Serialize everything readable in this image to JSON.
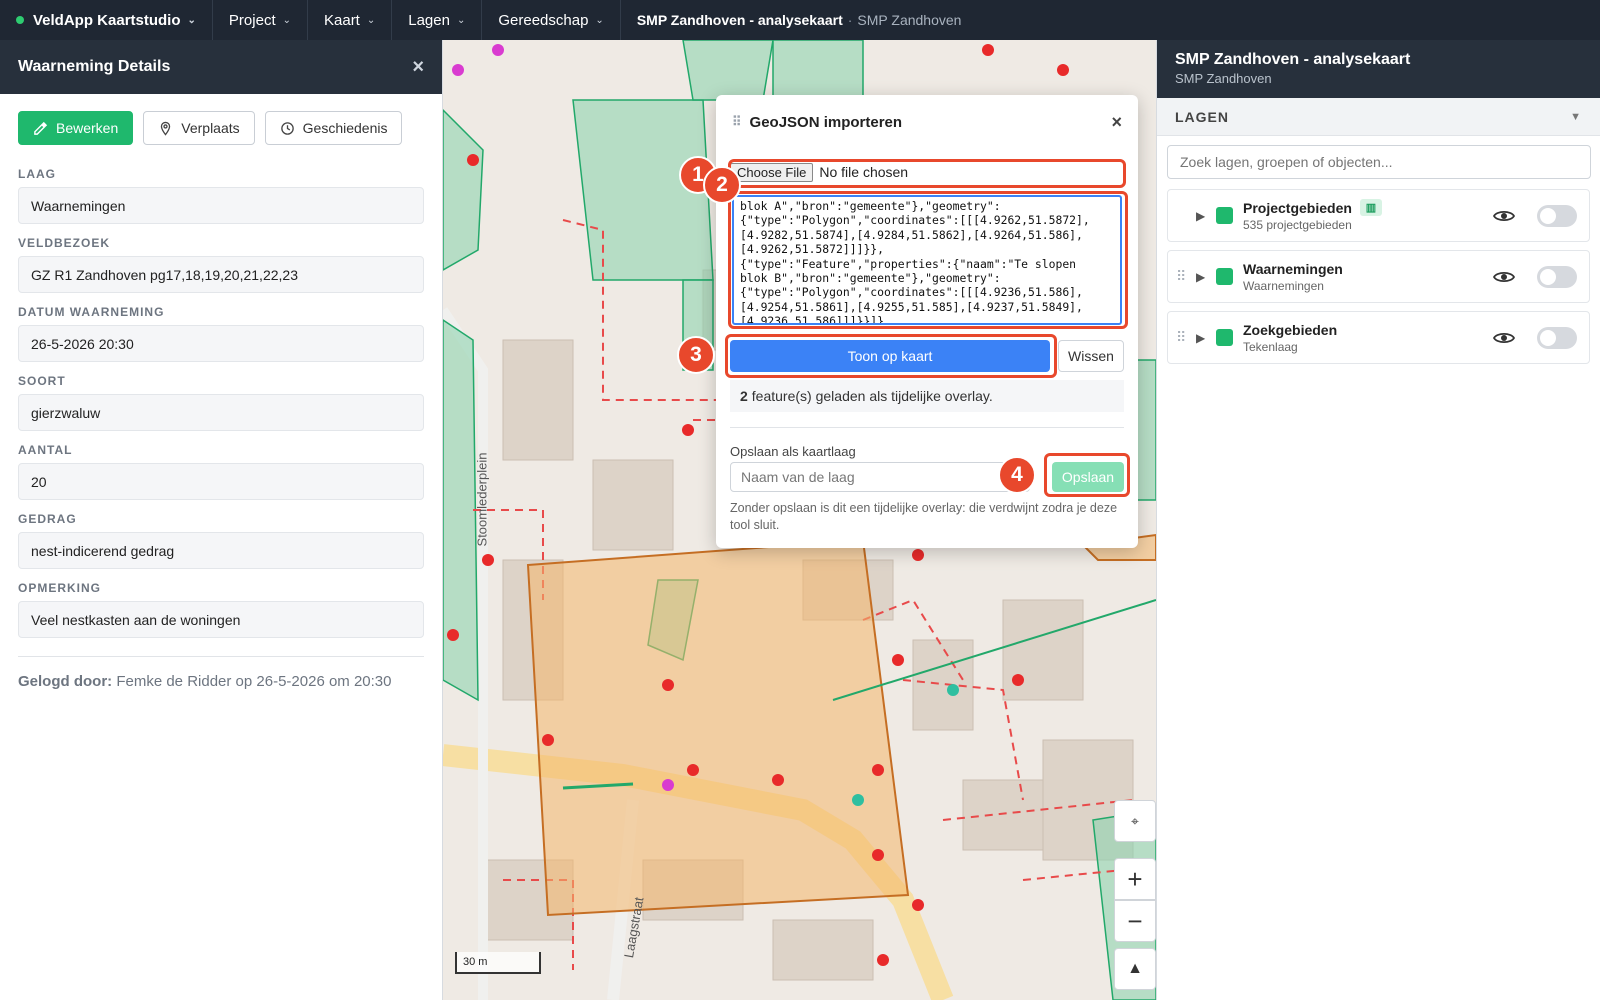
{
  "topbar": {
    "brand": "VeldApp Kaartstudio",
    "menus": [
      "Project",
      "Kaart",
      "Lagen",
      "Gereedschap"
    ],
    "breadcrumb_main": "SMP Zandhoven - analysekaart",
    "breadcrumb_separator": "·",
    "breadcrumb_sub": "SMP Zandhoven"
  },
  "left_panel": {
    "title": "Waarneming Details",
    "close": "×",
    "buttons": {
      "edit": "Bewerken",
      "move": "Verplaats",
      "history": "Geschiedenis"
    },
    "fields": [
      {
        "label": "LAAG",
        "value": "Waarnemingen"
      },
      {
        "label": "VELDBEZOEK",
        "value": "GZ R1 Zandhoven pg17,18,19,20,21,22,23"
      },
      {
        "label": "DATUM WAARNEMING",
        "value": "26-5-2026 20:30"
      },
      {
        "label": "SOORT",
        "value": "gierzwaluw"
      },
      {
        "label": "AANTAL",
        "value": "20"
      },
      {
        "label": "GEDRAG",
        "value": "nest-indicerend gedrag"
      },
      {
        "label": "OPMERKING",
        "value": "Veel nestkasten aan de woningen"
      }
    ],
    "logged_by_label": "Gelogd door:",
    "logged_by_value": "Femke de Ridder op 26-5-2026 om 20:30"
  },
  "map": {
    "street_labels": [
      "Stoomlederplein",
      "Laagstraat"
    ],
    "scale_label": "30 m",
    "zoom_in": "+",
    "zoom_out": "−"
  },
  "dialog": {
    "title": "GeoJSON importeren",
    "close": "×",
    "file_button": "Choose File",
    "file_status": "No file chosen",
    "geojson_text": "blok A\",\"bron\":\"gemeente\"},\"geometry\":\n{\"type\":\"Polygon\",\"coordinates\":[[[4.9262,51.5872],\n[4.9282,51.5874],[4.9284,51.5862],[4.9264,51.586],\n[4.9262,51.5872]]]}},\n{\"type\":\"Feature\",\"properties\":{\"naam\":\"Te slopen\nblok B\",\"bron\":\"gemeente\"},\"geometry\":\n{\"type\":\"Polygon\",\"coordinates\":[[[4.9236,51.586],\n[4.9254,51.5861],[4.9255,51.585],[4.9237,51.5849],\n[4.9236,51.586]]]}}]}",
    "show_button": "Toon op kaart",
    "clear_button": "Wissen",
    "status_count": "2",
    "status_text": "feature(s) geladen als tijdelijke overlay.",
    "save_label": "Opslaan als kaartlaag",
    "name_placeholder": "Naam van de laag",
    "save_button": "Opslaan",
    "note": "Zonder opslaan is dit een tijdelijke overlay: die verdwijnt zodra je deze tool sluit."
  },
  "callouts": [
    "1",
    "2",
    "3",
    "4"
  ],
  "right_panel": {
    "title": "SMP Zandhoven - analysekaart",
    "subtitle": "SMP Zandhoven",
    "section": "LAGEN",
    "search_placeholder": "Zoek lagen, groepen of objecten...",
    "layers": [
      {
        "name": "Projectgebieden",
        "sub": "535 projectgebieden"
      },
      {
        "name": "Waarnemingen",
        "sub": "Waarnemingen"
      },
      {
        "name": "Zoekgebieden",
        "sub": "Tekenlaag"
      }
    ]
  },
  "colors": {
    "accent_green": "#1fb86d",
    "primary_blue": "#3b82f6",
    "callout_red": "#e8482c",
    "header_dark": "#1f2733"
  }
}
